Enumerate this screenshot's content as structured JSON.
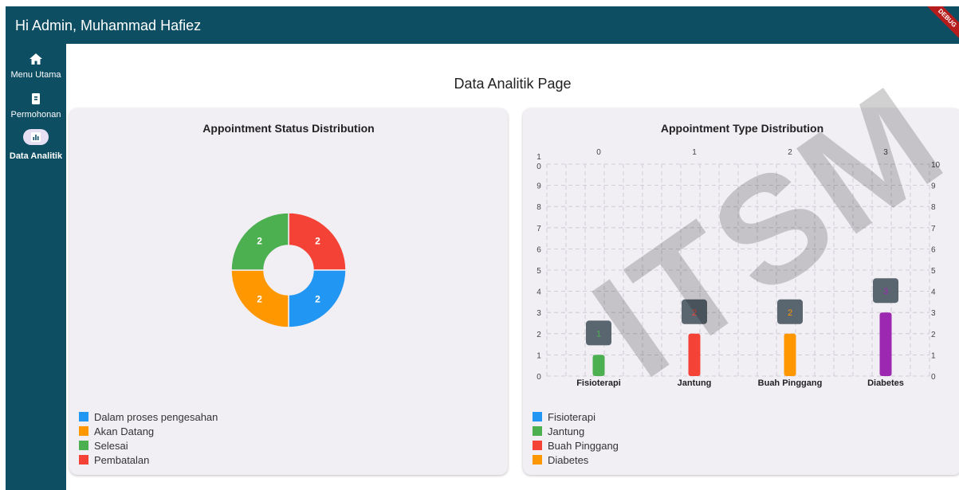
{
  "appbar": {
    "title": "Hi Admin, Muhammad Hafiez",
    "debug_label": "DEBUG"
  },
  "sidebar": {
    "items": [
      {
        "label": "Menu Utama",
        "icon": "home-icon"
      },
      {
        "label": "Permohonan",
        "icon": "document-icon"
      },
      {
        "label": "Data Analitik",
        "icon": "analytics-icon"
      }
    ]
  },
  "page": {
    "title": "Data Analitik Page"
  },
  "status_chart": {
    "title": "Appointment Status Distribution",
    "legend": [
      {
        "label": "Dalam proses pengesahan",
        "color": "#2196f3"
      },
      {
        "label": "Akan Datang",
        "color": "#ff9800"
      },
      {
        "label": "Selesai",
        "color": "#4caf50"
      },
      {
        "label": "Pembatalan",
        "color": "#f44336"
      }
    ]
  },
  "type_chart": {
    "title": "Appointment Type Distribution",
    "legend": [
      {
        "label": "Fisioterapi",
        "color": "#2196f3"
      },
      {
        "label": "Jantung",
        "color": "#4caf50"
      },
      {
        "label": "Buah Pinggang",
        "color": "#f44336"
      },
      {
        "label": "Diabetes",
        "color": "#ff9800"
      }
    ]
  },
  "watermark": "ITSM",
  "chart_data": [
    {
      "type": "pie",
      "title": "Appointment Status Distribution",
      "slices": [
        {
          "label": "Pembatalan",
          "value": 2,
          "color": "#f44336"
        },
        {
          "label": "Dalam proses pengesahan",
          "value": 2,
          "color": "#2196f3"
        },
        {
          "label": "Akan Datang",
          "value": 2,
          "color": "#ff9800"
        },
        {
          "label": "Selesai",
          "value": 2,
          "color": "#4caf50"
        }
      ],
      "legend_position": "bottom-left"
    },
    {
      "type": "bar",
      "title": "Appointment Type Distribution",
      "categories": [
        "Fisioterapi",
        "Jantung",
        "Buah Pinggang",
        "Diabetes"
      ],
      "values": [
        1,
        2,
        2,
        3
      ],
      "bar_colors": [
        "#4caf50",
        "#f44336",
        "#ff9800",
        "#9c27b0"
      ],
      "top_ticks": [
        "0",
        "1",
        "2",
        "3"
      ],
      "y_ticks": [
        0,
        1,
        2,
        3,
        4,
        5,
        6,
        7,
        8,
        9,
        10
      ],
      "ylim": [
        0,
        10
      ],
      "grid": true,
      "legend_position": "bottom-left"
    }
  ]
}
